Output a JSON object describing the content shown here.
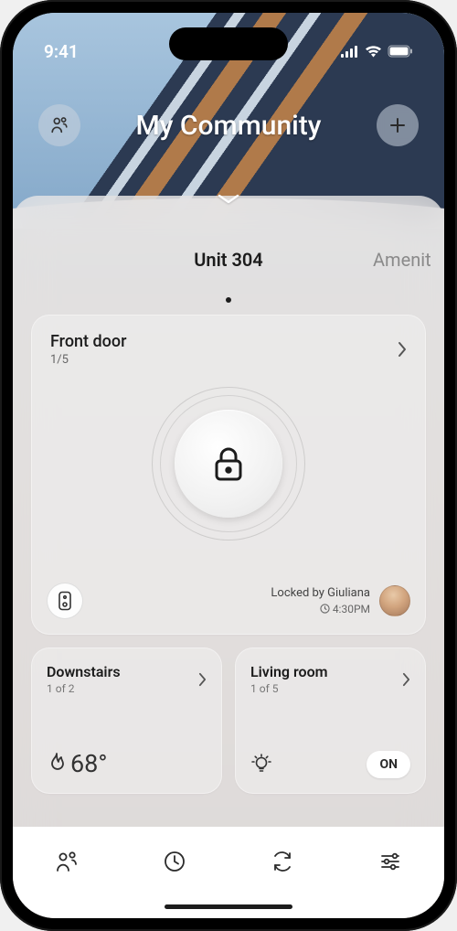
{
  "status": {
    "time": "9:41"
  },
  "header": {
    "title": "My Community"
  },
  "tabs": {
    "active": "Unit 304",
    "next": "Amenit"
  },
  "main_card": {
    "title": "Front door",
    "count": "1/5",
    "locked_by_line": "Locked by Giuliana",
    "locked_time": "4:30PM"
  },
  "card_downstairs": {
    "title": "Downstairs",
    "count": "1 of 2",
    "temp": "68°"
  },
  "card_living": {
    "title": "Living room",
    "count": "1 of 5",
    "state": "ON"
  }
}
